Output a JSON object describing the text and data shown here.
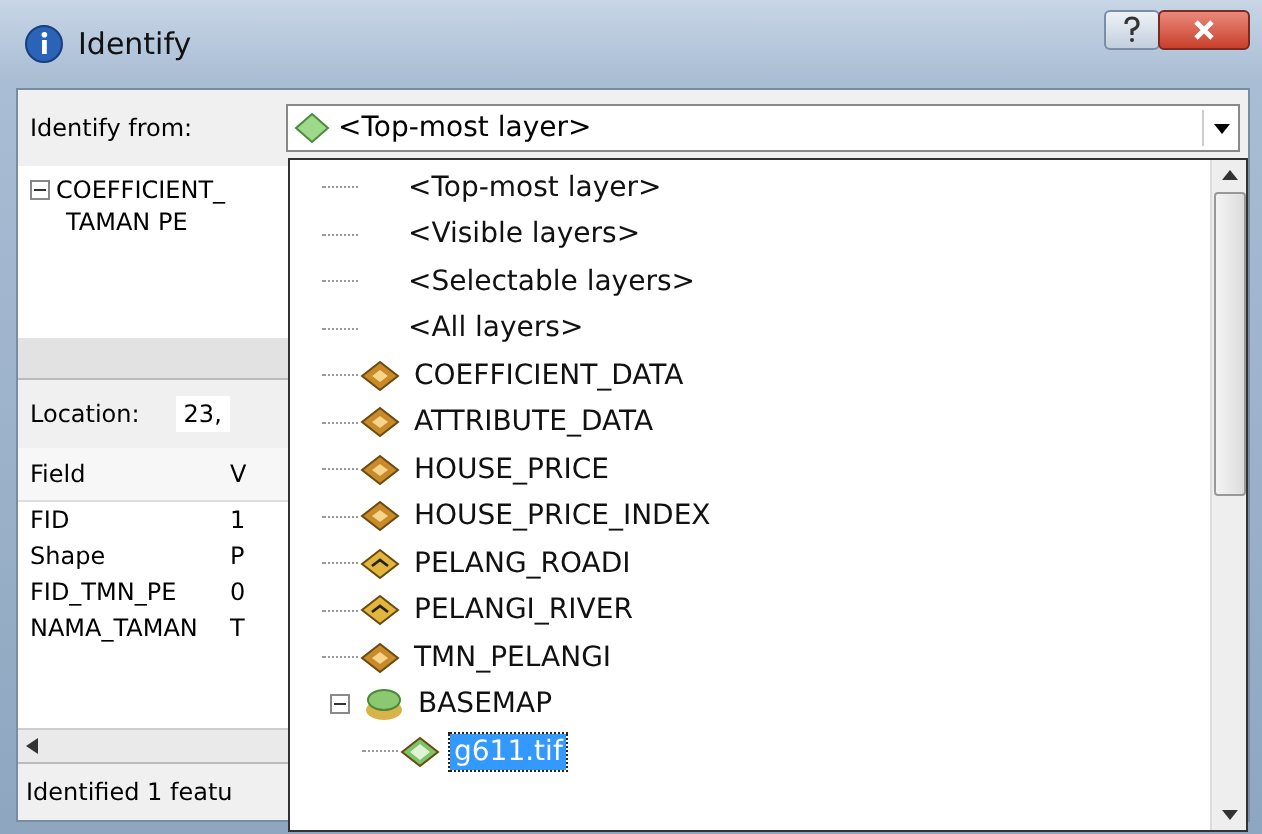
{
  "window": {
    "title": "Identify"
  },
  "identify_from": {
    "label": "Identify from:",
    "value": "<Top-most layer>"
  },
  "results_tree": [
    {
      "label": "COEFFICIENT_",
      "expanded": true,
      "children": [
        {
          "label": "TAMAN PE"
        }
      ]
    }
  ],
  "location": {
    "label": "Location:",
    "value": "23,"
  },
  "fields_table": {
    "columns": [
      "Field",
      "V"
    ],
    "rows": [
      [
        "FID",
        "1"
      ],
      [
        "Shape",
        "P"
      ],
      [
        "FID_TMN_PE",
        "0"
      ],
      [
        "NAMA_TAMAN",
        "T"
      ]
    ]
  },
  "status_bar": "Identified 1 featu",
  "dropdown": {
    "items": [
      {
        "label": "<Top-most layer>",
        "kind": "option",
        "selected": false
      },
      {
        "label": "<Visible layers>",
        "kind": "option",
        "selected": false
      },
      {
        "label": "<Selectable layers>",
        "kind": "option",
        "selected": false
      },
      {
        "label": "<All layers>",
        "kind": "option",
        "selected": false
      },
      {
        "label": "COEFFICIENT_DATA",
        "kind": "point-layer",
        "selected": false
      },
      {
        "label": "ATTRIBUTE_DATA",
        "kind": "point-layer",
        "selected": false
      },
      {
        "label": "HOUSE_PRICE",
        "kind": "point-layer",
        "selected": false
      },
      {
        "label": "HOUSE_PRICE_INDEX",
        "kind": "point-layer",
        "selected": false
      },
      {
        "label": "PELANG_ROADI",
        "kind": "line-layer",
        "selected": false
      },
      {
        "label": "PELANGI_RIVER",
        "kind": "line-layer",
        "selected": false
      },
      {
        "label": "TMN_PELANGI",
        "kind": "point-layer",
        "selected": false
      },
      {
        "label": "BASEMAP",
        "kind": "group",
        "selected": false,
        "expanded": true,
        "children": [
          {
            "label": "g611.tif",
            "kind": "raster",
            "selected": true
          }
        ]
      }
    ]
  }
}
